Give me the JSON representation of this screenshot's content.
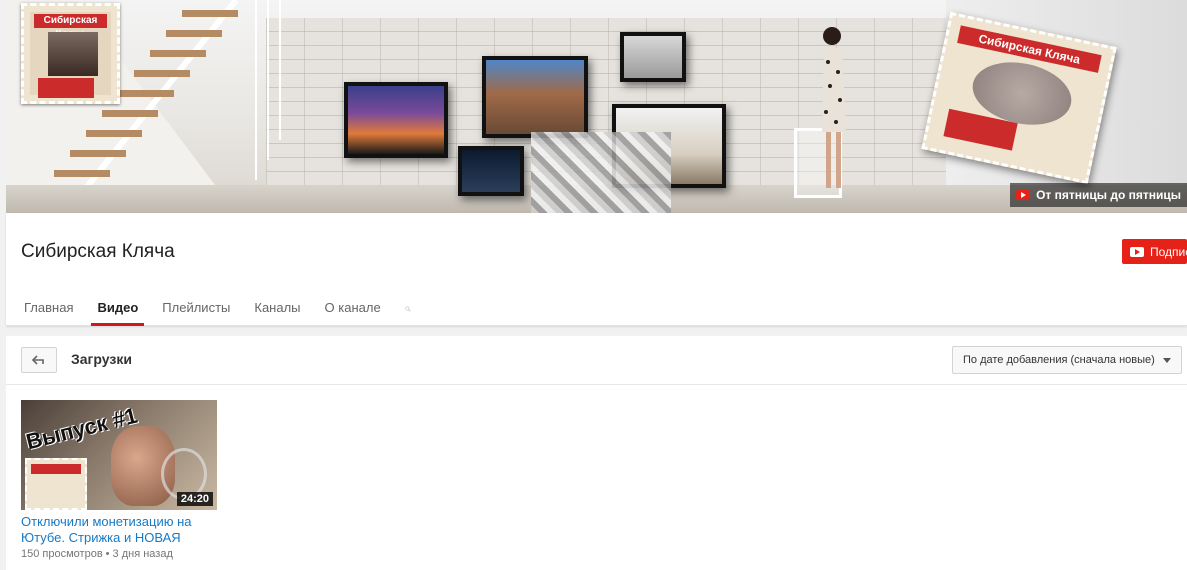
{
  "banner": {
    "avatar_title": "Сибирская Кляча",
    "stamp_title": "Сибирская Кляча",
    "channel_link": "От пятницы до пятницы",
    "colors": {
      "stamp_red": "#cc2b2b",
      "youtube_red": "#e62117"
    }
  },
  "header": {
    "channel_name": "Сибирская Кляча",
    "subscribe_label": "Подписаться",
    "tabs": [
      {
        "label": "Главная"
      },
      {
        "label": "Видео"
      },
      {
        "label": "Плейлисты"
      },
      {
        "label": "Каналы"
      },
      {
        "label": "О канале"
      }
    ],
    "active_tab": "Видео",
    "search_icon": "search-icon"
  },
  "content": {
    "section_title": "Загрузки",
    "back_icon": "back-arrow-icon",
    "sort_label": "По дате добавления (сначала новые)",
    "videos": [
      {
        "thumb_text": "Выпуск #1",
        "duration": "24:20",
        "title": "Отключили монетизацию на Ютубе. Стрижка и НОВАЯ",
        "views": "150 просмотров",
        "age": "3 дня назад"
      }
    ]
  }
}
